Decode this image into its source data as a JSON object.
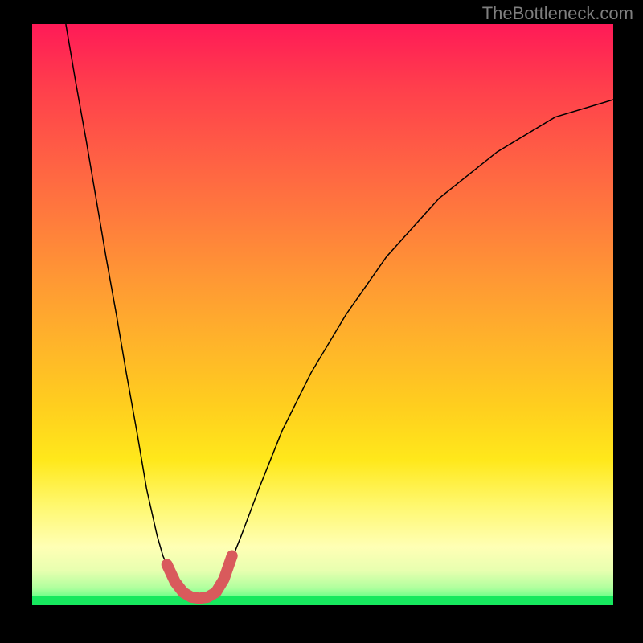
{
  "watermark": "TheBottleneck.com",
  "chart_data": {
    "type": "line",
    "title": "",
    "xlabel": "",
    "ylabel": "",
    "xlim": [
      0,
      1
    ],
    "ylim": [
      0,
      1
    ],
    "series": [
      {
        "name": "left-branch",
        "x": [
          0.058,
          0.075,
          0.093,
          0.11,
          0.127,
          0.145,
          0.162,
          0.18,
          0.197,
          0.215,
          0.225,
          0.236,
          0.246,
          0.254,
          0.262,
          0.27,
          0.278,
          0.286
        ],
        "y": [
          1.0,
          0.9,
          0.8,
          0.7,
          0.6,
          0.5,
          0.4,
          0.3,
          0.2,
          0.12,
          0.085,
          0.06,
          0.04,
          0.028,
          0.02,
          0.015,
          0.012,
          0.011
        ]
      },
      {
        "name": "right-branch",
        "x": [
          0.286,
          0.294,
          0.303,
          0.312,
          0.325,
          0.34,
          0.36,
          0.39,
          0.43,
          0.48,
          0.54,
          0.61,
          0.7,
          0.8,
          0.9,
          1.0
        ],
        "y": [
          0.011,
          0.012,
          0.016,
          0.024,
          0.04,
          0.07,
          0.12,
          0.2,
          0.3,
          0.4,
          0.5,
          0.6,
          0.7,
          0.78,
          0.84,
          0.87
        ]
      },
      {
        "name": "highlight-bottom",
        "x": [
          0.232,
          0.246,
          0.26,
          0.274,
          0.288,
          0.302,
          0.316,
          0.33,
          0.344
        ],
        "y": [
          0.07,
          0.04,
          0.022,
          0.014,
          0.012,
          0.014,
          0.022,
          0.045,
          0.085
        ]
      }
    ],
    "annotations": []
  }
}
